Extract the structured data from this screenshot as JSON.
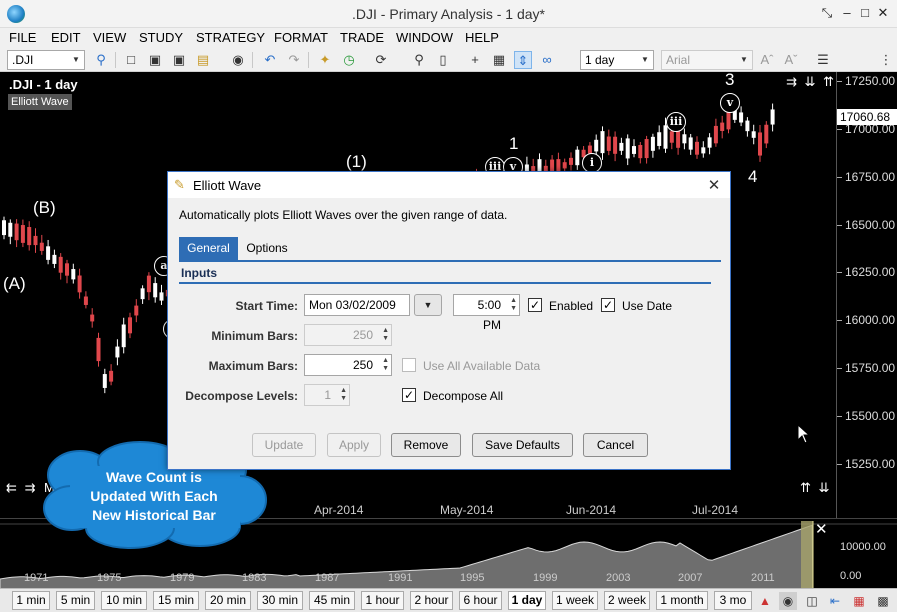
{
  "window": {
    "title": ".DJI - Primary Analysis - 1 day*",
    "controls": [
      "⤡",
      "–",
      "□",
      "✕"
    ]
  },
  "menu": [
    "FILE",
    "EDIT",
    "VIEW",
    "STUDY",
    "STRATEGY",
    "FORMAT",
    "TRADE",
    "WINDOW",
    "HELP"
  ],
  "toolbar": {
    "symbol": ".DJI",
    "interval": "1 day",
    "font": "Arial"
  },
  "chart": {
    "symbol_label": ".DJI - 1 day",
    "study_tag": "Elliott Wave",
    "last_price": "17060.68",
    "price_levels": [
      "17250.00",
      "17000.00",
      "16750.00",
      "16500.00",
      "16250.00",
      "16000.00",
      "15750.00",
      "15500.00",
      "15250.00"
    ],
    "dates": [
      "Apr-2014",
      "May-2014",
      "Jun-2014",
      "Jul-2014"
    ],
    "wave_labels": [
      "(A)",
      "(B)",
      "(1)",
      "1",
      "3",
      "4"
    ],
    "wave_circles": [
      "a",
      "c",
      "iii",
      "v",
      "i",
      "iii",
      "v"
    ],
    "nav_left": "⇇ ⇉",
    "nav_right": "⇉ ⇊ ⇈",
    "nav_bottom": "⇈ ⇊",
    "partial_text": "M"
  },
  "overview": {
    "years": [
      "1971",
      "1975",
      "1979",
      "1983",
      "1987",
      "1991",
      "1995",
      "1999",
      "2003",
      "2007",
      "2011"
    ],
    "values": [
      "10000.00",
      "0.00"
    ]
  },
  "interval_tabs": [
    "1 min",
    "5 min",
    "10 min",
    "15 min",
    "20 min",
    "30 min",
    "45 min",
    "1 hour",
    "2 hour",
    "6 hour",
    "1 day",
    "1 week",
    "2 week",
    "1 month",
    "3 mo"
  ],
  "active_tab": "1 day",
  "dialog": {
    "title": "Elliott Wave",
    "description": "Automatically plots Elliott Waves over the given range of data.",
    "tabs": [
      "General",
      "Options"
    ],
    "section": "Inputs",
    "start_time_label": "Start Time:",
    "start_date": "Mon 03/02/2009",
    "start_clock": "5:00 PM",
    "enabled_label": "Enabled",
    "use_date_label": "Use Date",
    "min_bars_label": "Minimum Bars:",
    "min_bars": "250",
    "max_bars_label": "Maximum Bars:",
    "max_bars": "250",
    "use_all_label": "Use All Available Data",
    "decompose_label": "Decompose Levels:",
    "decompose_levels": "1",
    "decompose_all_label": "Decompose All",
    "buttons": {
      "update": "Update",
      "apply": "Apply",
      "remove": "Remove",
      "save_defaults": "Save Defaults",
      "cancel": "Cancel"
    }
  },
  "callout": {
    "line1": "Wave Count is",
    "line2": "Updated With Each",
    "line3": "New Historical Bar"
  },
  "colors": {
    "chart_bg": "#000000",
    "up_candle": "#ffffff",
    "down_candle": "#e0474c",
    "accent": "#2e6db5",
    "callout": "#1e88d6"
  }
}
